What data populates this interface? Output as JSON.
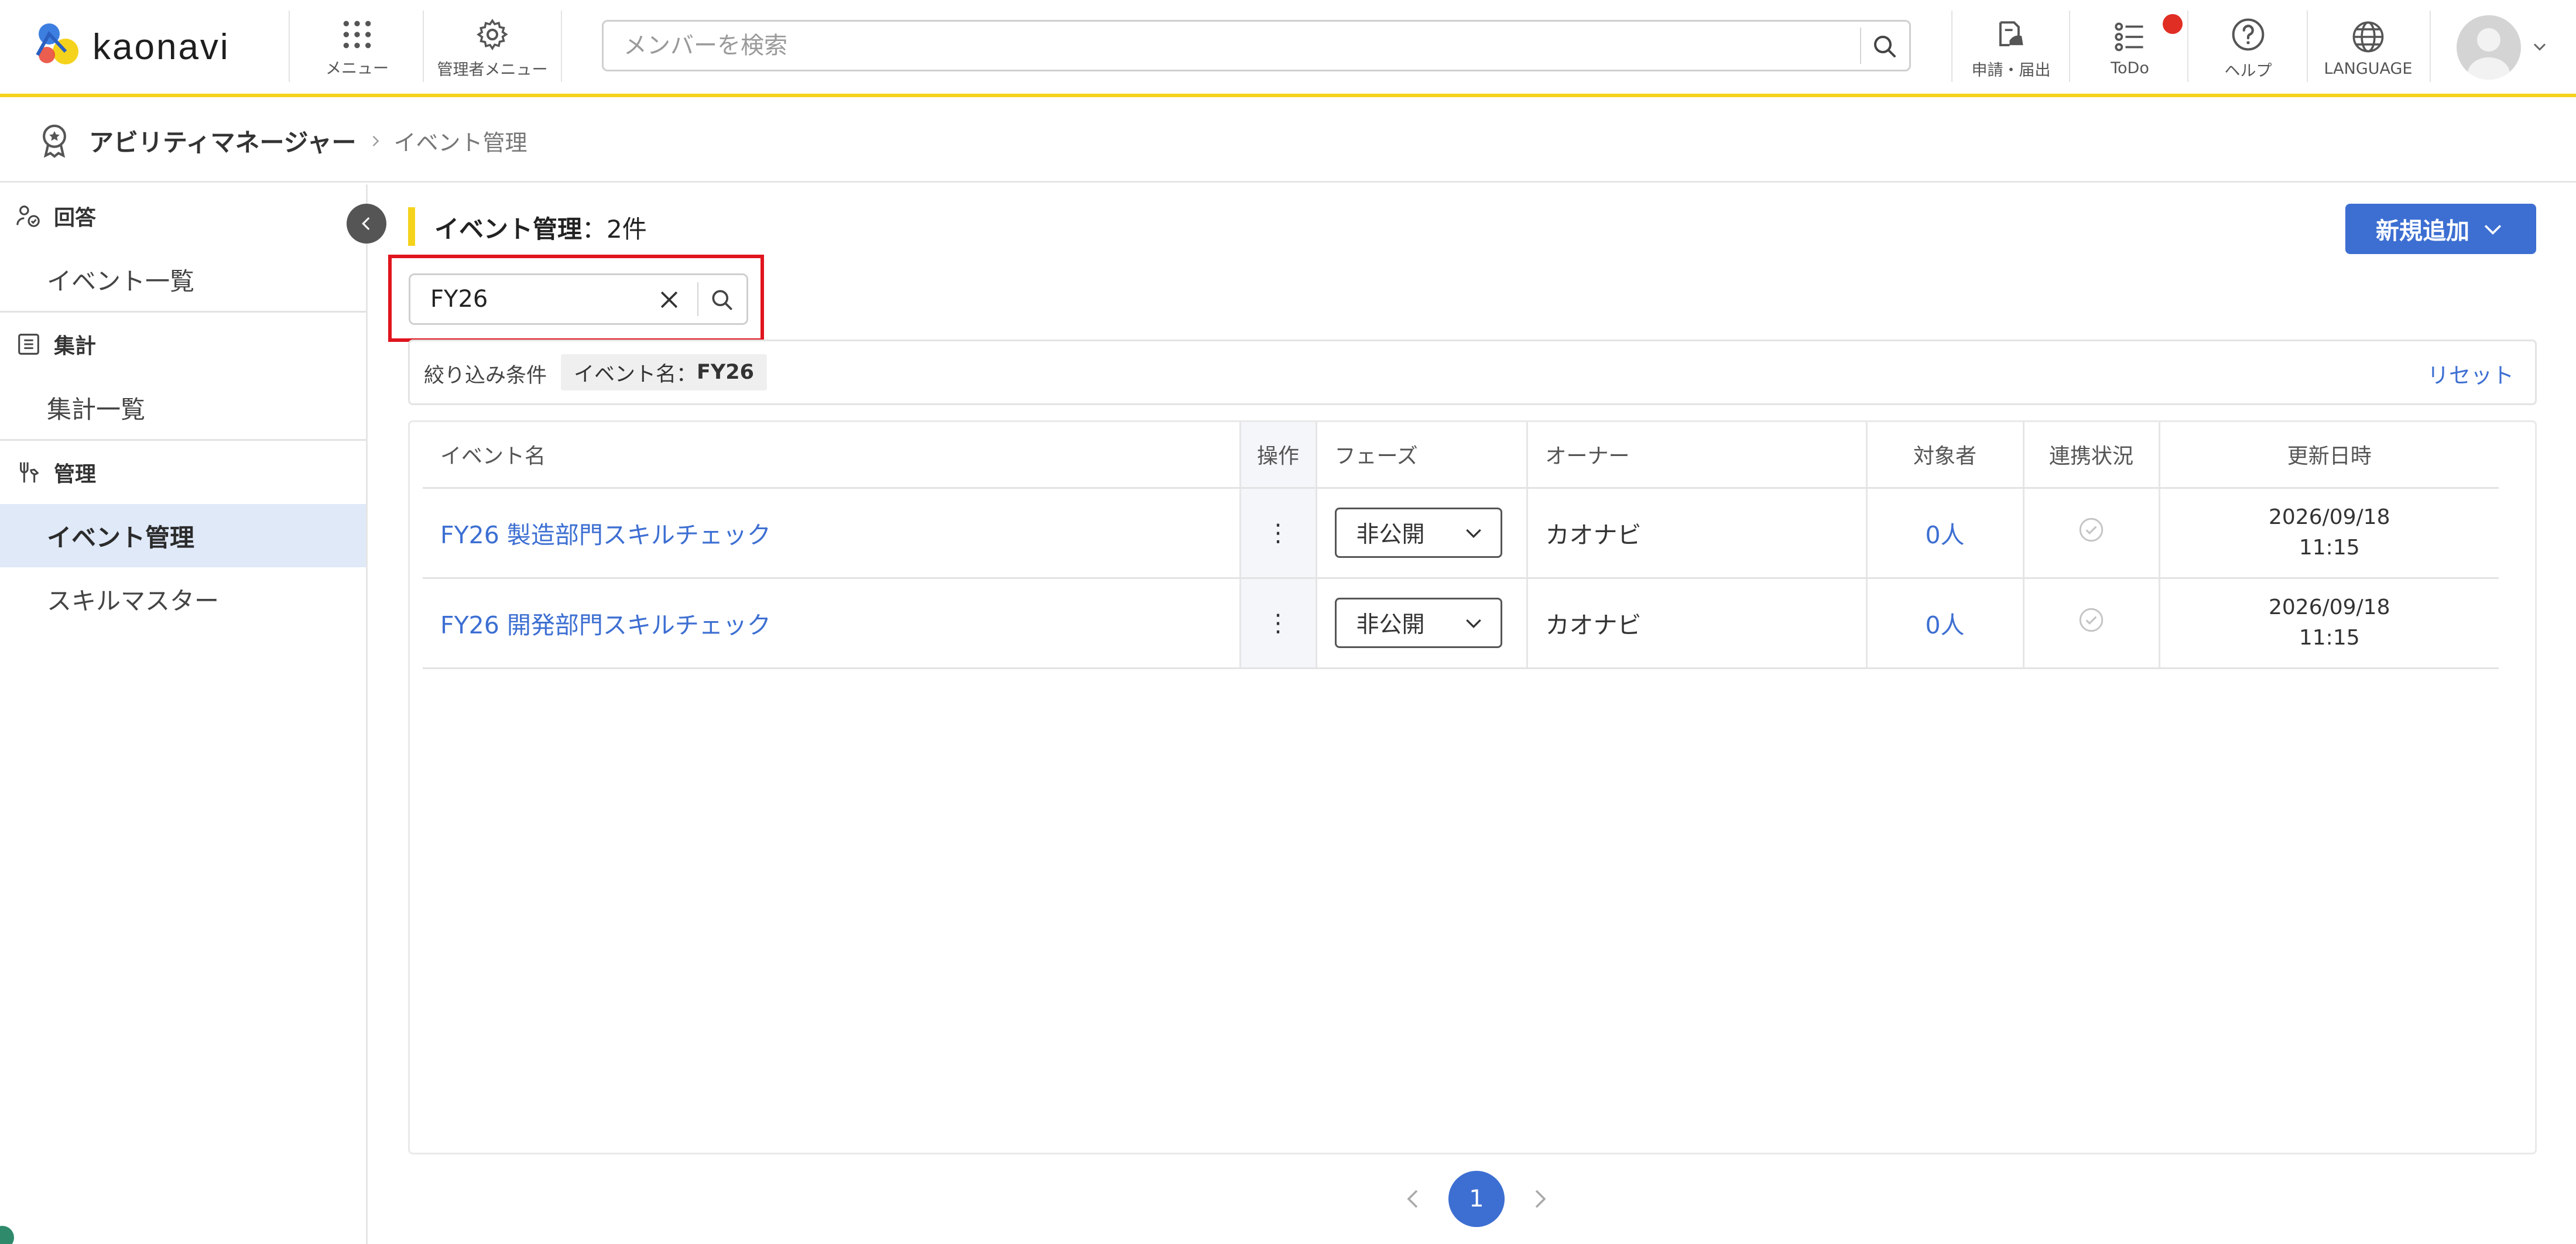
{
  "app": {
    "logo_text": "kaonavi",
    "brand_color": "#f5d31c",
    "accent_color": "#3d6fd2"
  },
  "header": {
    "menu_label": "メニュー",
    "admin_menu_label": "管理者メニュー",
    "search_placeholder": "メンバーを検索",
    "apply_label": "申請・届出",
    "todo_label": "ToDo",
    "help_label": "ヘルプ",
    "language_label": "LANGUAGE",
    "icons": [
      "grid-icon",
      "gear-icon",
      "search-icon",
      "application-icon",
      "todo-icon",
      "help-icon",
      "globe-icon",
      "avatar-icon"
    ]
  },
  "breadcrumb": {
    "app_name": "アビリティマネージャー",
    "current": "イベント管理"
  },
  "sidebar": {
    "sections": [
      {
        "title": "回答",
        "items": [
          {
            "label": "イベント一覧"
          }
        ]
      },
      {
        "title": "集計",
        "items": [
          {
            "label": "集計一覧"
          }
        ]
      },
      {
        "title": "管理",
        "items": [
          {
            "label": "イベント管理",
            "active": true
          },
          {
            "label": "スキルマスター"
          }
        ]
      }
    ]
  },
  "main": {
    "title": "イベント管理",
    "count_text": "：2件",
    "add_button_label": "新規追加",
    "search_value": "FY26",
    "filter": {
      "label": "絞り込み条件",
      "chip_key": "イベント名：",
      "chip_value": "FY26",
      "reset_label": "リセット"
    },
    "table": {
      "headers": [
        "イベント名",
        "操作",
        "フェーズ",
        "オーナー",
        "対象者",
        "連携状況",
        "更新日時"
      ],
      "rows": [
        {
          "name": "FY26 製造部門スキルチェック",
          "op": "⋮",
          "phase": "非公開",
          "owner": "カオナビ",
          "target": "0人",
          "date": "2026/09/18",
          "time": "11:15"
        },
        {
          "name": "FY26 開発部門スキルチェック",
          "op": "⋮",
          "phase": "非公開",
          "owner": "カオナビ",
          "target": "0人",
          "date": "2026/09/18",
          "time": "11:15"
        }
      ]
    },
    "pagination": {
      "current_page": "1"
    }
  }
}
